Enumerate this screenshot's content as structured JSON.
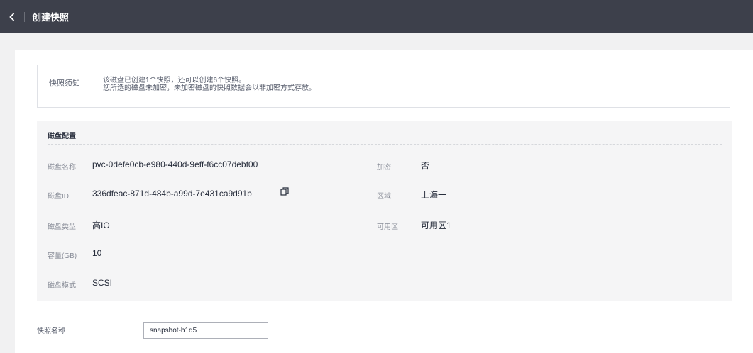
{
  "header": {
    "title": "创建快照",
    "back_icon": "chevron-left-icon"
  },
  "notice": {
    "label": "快照须知",
    "lines": [
      "该磁盘已创建1个快照，还可以创建6个快照。",
      "您所选的磁盘未加密，未加密磁盘的快照数据会以非加密方式存放。"
    ]
  },
  "disk_config": {
    "title": "磁盘配置",
    "name": {
      "label": "磁盘名称",
      "value": "pvc-0defe0cb-e980-440d-9eff-f6cc07debf00"
    },
    "id": {
      "label": "磁盘ID",
      "value": "336dfeac-871d-484b-a99d-7e431ca9d91b",
      "copy_icon": "copy-icon"
    },
    "type": {
      "label": "磁盘类型",
      "value": "高IO"
    },
    "capacity": {
      "label": "容量(GB)",
      "value": "10"
    },
    "mode": {
      "label": "磁盘模式",
      "value": "SCSI"
    },
    "encryption": {
      "label": "加密",
      "value": "否"
    },
    "region": {
      "label": "区域",
      "value": "上海一"
    },
    "az": {
      "label": "可用区",
      "value": "可用区1"
    }
  },
  "snapshot_name": {
    "label": "快照名称",
    "value": "snapshot-b1d5"
  },
  "colors": {
    "topbar": "#3d404b",
    "page_bg": "#f1f1f2",
    "panel_bg": "#f5f5f6"
  }
}
